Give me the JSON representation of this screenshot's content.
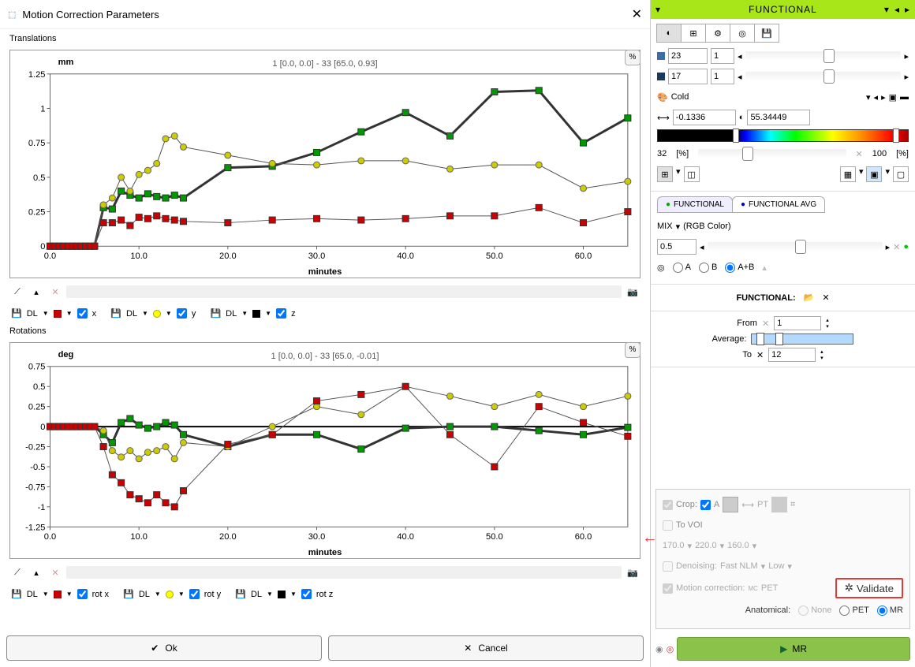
{
  "dialog": {
    "title": "Motion Correction Parameters",
    "translations": {
      "label": "Translations",
      "ylabel": "mm",
      "title": "1 [0.0, 0.0] - 33 [65.0, 0.93]",
      "xlabel": "minutes"
    },
    "rotations": {
      "label": "Rotations",
      "ylabel": "deg",
      "title": "1 [0.0, 0.0] - 33 [65.0, -0.01]",
      "xlabel": "minutes"
    },
    "dl": "DL",
    "legend_t": {
      "x": "x",
      "y": "y",
      "z": "z"
    },
    "legend_r": {
      "x": "rot x",
      "y": "rot y",
      "z": "rot z"
    },
    "ok": "Ok",
    "cancel": "Cancel",
    "pct": "%"
  },
  "sidebar": {
    "header": "FUNCTIONAL",
    "val1": "23",
    "val1b": "1",
    "val2": "17",
    "val2b": "1",
    "palette": "Cold",
    "lo": "-0.1336",
    "hi": "55.34449",
    "pct_lo": "32",
    "pct_hi": "100",
    "pct_unit": "[%]",
    "tab1": "FUNCTIONAL",
    "tab2": "FUNCTIONAL AVG",
    "mix": "MIX",
    "rgb": "(RGB Color)",
    "mixval": "0.5",
    "a": "A",
    "b": "B",
    "ab": "A+B",
    "func_label": "FUNCTIONAL:",
    "from": "From",
    "to": "To",
    "avg": "Average:",
    "from_val": "1",
    "to_val": "12",
    "crop": "Crop:",
    "tovoi": "To VOI",
    "acb": "A",
    "pt": "PT",
    "c1": "170.0",
    "c2": "220.0",
    "c3": "160.0",
    "denoise": "Denoising:",
    "fastnlm": "Fast NLM",
    "low": "Low",
    "motion": "Motion correction:",
    "pet": "PET",
    "validate": "Validate",
    "anat": "Anatomical:",
    "none": "None",
    "anat_pet": "PET",
    "mr": "MR",
    "mr_btn": "MR"
  },
  "chart_data": [
    {
      "type": "line",
      "title": "1 [0.0, 0.0] - 33 [65.0, 0.93]",
      "xlabel": "minutes",
      "ylabel": "mm",
      "xlim": [
        0,
        65
      ],
      "ylim": [
        0,
        1.25
      ],
      "x": [
        0,
        0.5,
        1,
        1.5,
        2,
        2.5,
        3,
        3.5,
        4,
        4.5,
        5,
        6,
        7,
        8,
        9,
        10,
        11,
        12,
        13,
        14,
        15,
        20,
        25,
        30,
        35,
        40,
        45,
        50,
        55,
        60,
        65
      ],
      "series": [
        {
          "name": "x",
          "color": "#009900",
          "marker": "square",
          "values": [
            0,
            0,
            0,
            0,
            0,
            0,
            0,
            0,
            0,
            0,
            0,
            0.28,
            0.27,
            0.4,
            0.37,
            0.35,
            0.38,
            0.36,
            0.35,
            0.37,
            0.35,
            0.57,
            0.58,
            0.68,
            0.83,
            0.97,
            0.8,
            1.12,
            1.13,
            0.75,
            0.93
          ]
        },
        {
          "name": "y",
          "color": "#cccc00",
          "marker": "circle",
          "values": [
            0,
            0,
            0,
            0,
            0,
            0,
            0,
            0,
            0,
            0,
            0,
            0.3,
            0.35,
            0.5,
            0.4,
            0.52,
            0.55,
            0.6,
            0.78,
            0.8,
            0.72,
            0.66,
            0.6,
            0.59,
            0.62,
            0.62,
            0.56,
            0.59,
            0.59,
            0.42,
            0.47
          ]
        },
        {
          "name": "z",
          "color": "#cc0000",
          "marker": "square",
          "values": [
            0,
            0,
            0,
            0,
            0,
            0,
            0,
            0,
            0,
            0,
            0,
            0.17,
            0.17,
            0.19,
            0.15,
            0.21,
            0.2,
            0.22,
            0.2,
            0.19,
            0.18,
            0.17,
            0.19,
            0.2,
            0.19,
            0.2,
            0.22,
            0.22,
            0.28,
            0.17,
            0.25
          ]
        }
      ]
    },
    {
      "type": "line",
      "title": "1 [0.0, 0.0] - 33 [65.0, -0.01]",
      "xlabel": "minutes",
      "ylabel": "deg",
      "xlim": [
        0,
        65
      ],
      "ylim": [
        -1.25,
        0.75
      ],
      "x": [
        0,
        0.5,
        1,
        1.5,
        2,
        2.5,
        3,
        3.5,
        4,
        4.5,
        5,
        6,
        7,
        8,
        9,
        10,
        11,
        12,
        13,
        14,
        15,
        20,
        25,
        30,
        35,
        40,
        45,
        50,
        55,
        60,
        65
      ],
      "series": [
        {
          "name": "rot x",
          "color": "#009900",
          "marker": "square",
          "values": [
            0,
            0,
            0,
            0,
            0,
            0,
            0,
            0,
            0,
            0,
            0,
            -0.1,
            -0.2,
            0.05,
            0.1,
            0.02,
            -0.02,
            0.0,
            0.05,
            0.02,
            -0.1,
            -0.25,
            -0.1,
            -0.1,
            -0.28,
            -0.02,
            0.0,
            0.0,
            -0.05,
            -0.1,
            -0.01
          ]
        },
        {
          "name": "rot y",
          "color": "#cccc00",
          "marker": "circle",
          "values": [
            0,
            0,
            0,
            0,
            0,
            0,
            0,
            0,
            0,
            0,
            0,
            -0.05,
            -0.3,
            -0.38,
            -0.3,
            -0.4,
            -0.32,
            -0.3,
            -0.25,
            -0.4,
            -0.2,
            -0.25,
            0.0,
            0.25,
            0.15,
            0.5,
            0.38,
            0.25,
            0.4,
            0.25,
            0.38
          ]
        },
        {
          "name": "rot z",
          "color": "#cc0000",
          "marker": "square",
          "values": [
            0,
            0,
            0,
            0,
            0,
            0,
            0,
            0,
            0,
            0,
            0,
            -0.25,
            -0.6,
            -0.7,
            -0.85,
            -0.9,
            -0.95,
            -0.85,
            -0.95,
            -1.0,
            -0.8,
            -0.22,
            -0.1,
            0.32,
            0.4,
            0.5,
            -0.1,
            -0.5,
            0.25,
            0.05,
            -0.12
          ]
        }
      ]
    }
  ]
}
